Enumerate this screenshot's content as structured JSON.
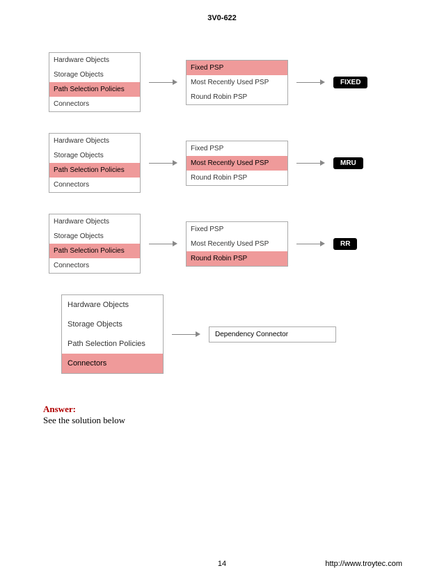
{
  "header": {
    "title": "3V0-622"
  },
  "left_items": {
    "i0": "Hardware Objects",
    "i1": "Storage Objects",
    "i2": "Path Selection Policies",
    "i3": "Connectors"
  },
  "mid_items": {
    "m0": "Fixed PSP",
    "m1": "Most Recently Used PSP",
    "m2": "Round Robin PSP"
  },
  "tags": {
    "fixed": "FIXED",
    "mru": "MRU",
    "rr": "RR"
  },
  "row4": {
    "result": "Dependency Connector"
  },
  "answer": {
    "label": "Answer:",
    "text": "See the solution below"
  },
  "footer": {
    "page": "14",
    "url": "http://www.troytec.com"
  }
}
